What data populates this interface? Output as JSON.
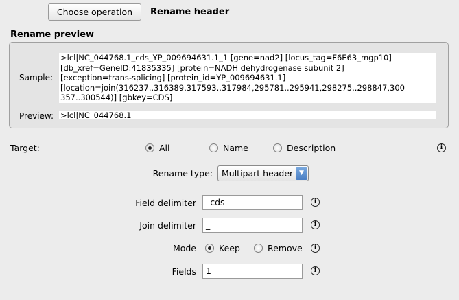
{
  "toolbar": {
    "choose_label": "Choose operation",
    "title": "Rename header"
  },
  "preview": {
    "section_title": "Rename preview",
    "sample_label": "Sample:",
    "sample_text": ">lcl|NC_044768.1_cds_YP_009694631.1_1 [gene=nad2] [locus_tag=F6E63_mgp10]\n[db_xref=GeneID:41835335] [protein=NADH dehydrogenase subunit 2]\n[exception=trans-splicing] [protein_id=YP_009694631.1]\n[location=join(316237..316389,317593..317984,295781..295941,298275..298847,300\n357..300544)] [gbkey=CDS]",
    "preview_label": "Preview:",
    "preview_text": ">lcl|NC_044768.1"
  },
  "target": {
    "label": "Target:",
    "options": [
      "All",
      "Name",
      "Description"
    ],
    "selected": "All"
  },
  "rename_type": {
    "label": "Rename type:",
    "value": "Multipart header"
  },
  "field_delimiter": {
    "label": "Field delimiter",
    "value": "_cds"
  },
  "join_delimiter": {
    "label": "Join delimiter",
    "value": "_"
  },
  "mode": {
    "label": "Mode",
    "options": [
      "Keep",
      "Remove"
    ],
    "selected": "Keep"
  },
  "fields": {
    "label": "Fields",
    "value": "1"
  },
  "icons": {
    "info": "info-icon"
  }
}
